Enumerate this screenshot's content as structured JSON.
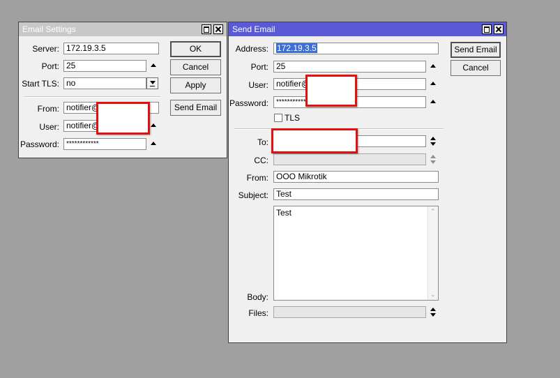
{
  "email_settings": {
    "title": "Email Settings",
    "labels": {
      "server": "Server:",
      "port": "Port:",
      "start_tls": "Start TLS:",
      "from": "From:",
      "user": "User:",
      "password": "Password:"
    },
    "values": {
      "server": "172.19.3.5",
      "port": "25",
      "start_tls": "no",
      "from": "notifier@",
      "user": "notifier@",
      "password": "************"
    },
    "buttons": {
      "ok": "OK",
      "cancel": "Cancel",
      "apply": "Apply",
      "send_email": "Send Email"
    }
  },
  "send_email": {
    "title": "Send Email",
    "labels": {
      "address": "Address:",
      "port": "Port:",
      "user": "User:",
      "password": "Password:",
      "tls": "TLS",
      "to": "To:",
      "cc": "CC:",
      "from": "From:",
      "subject": "Subject:",
      "body": "Body:",
      "files": "Files:"
    },
    "values": {
      "address": "172.19.3.5",
      "port": "25",
      "user": "notifier@",
      "password": "************",
      "to": "",
      "cc": "",
      "from": "OOO Mikrotik",
      "subject": "Test",
      "body": "Test",
      "files": ""
    },
    "tls_checked": false,
    "buttons": {
      "send_email": "Send Email",
      "cancel": "Cancel"
    }
  },
  "colors": {
    "active_title": "#5a5ad6",
    "inactive_title": "#c8c8c8",
    "redaction_border": "#e01010",
    "desktop": "#a0a0a0"
  }
}
